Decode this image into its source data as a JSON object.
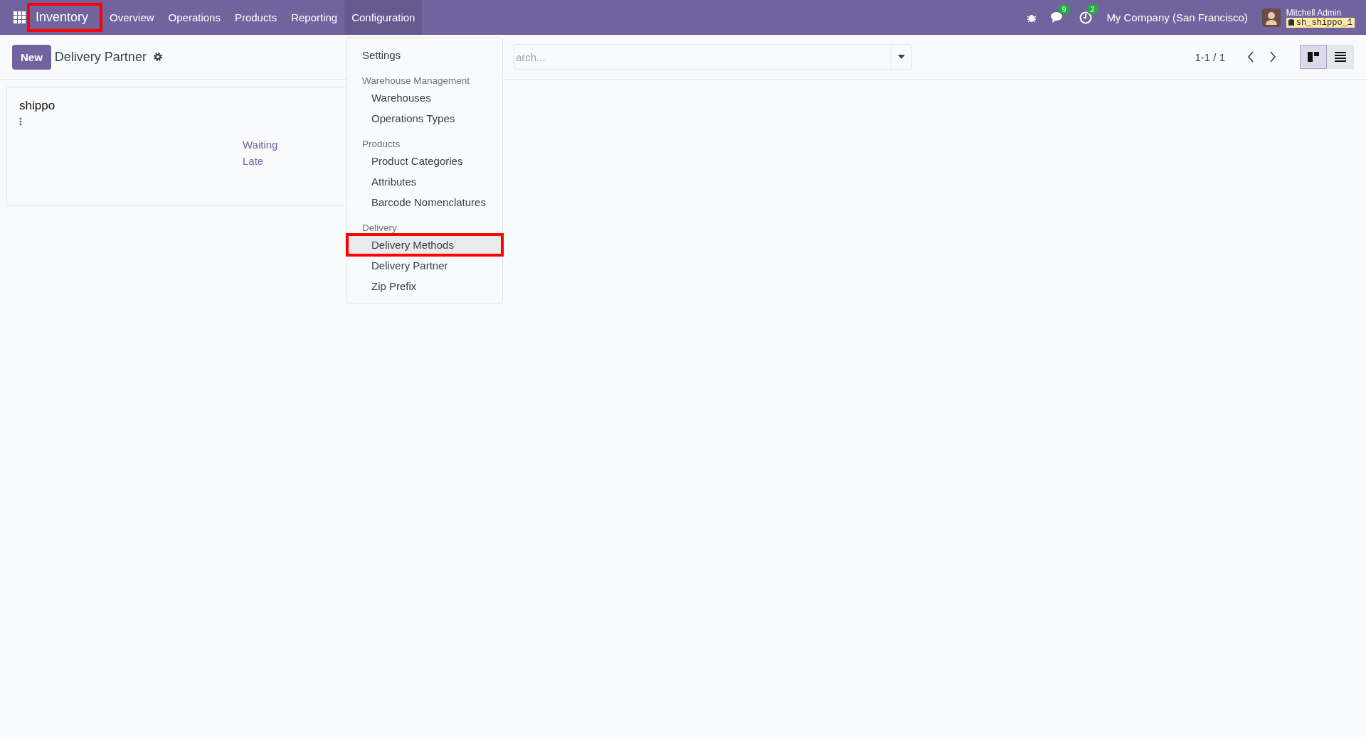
{
  "navbar": {
    "app_name": {
      "label": "Inventory",
      "highlighted": true
    },
    "menus": [
      {
        "label": "Overview",
        "selected": false
      },
      {
        "label": "Operations",
        "selected": false
      },
      {
        "label": "Products",
        "selected": false
      },
      {
        "label": "Reporting",
        "selected": false
      },
      {
        "label": "Configuration",
        "selected": true
      }
    ],
    "messages_badge": "9",
    "activities_badge": "2",
    "company": "My Company (San Francisco)",
    "user": "Mitchell Admin",
    "database": "sh_shippo_1"
  },
  "control_panel": {
    "new_button": "New",
    "title": "Delivery Partner",
    "search": {
      "placeholder": "arch..."
    },
    "pager": "1-1 / 1",
    "views": [
      {
        "kind": "kanban",
        "selected": true
      },
      {
        "kind": "list",
        "selected": false
      }
    ]
  },
  "card": {
    "title": "shippo",
    "links": [
      "Waiting",
      "Late"
    ]
  },
  "dropdown": [
    {
      "kind": "item",
      "label": "Settings",
      "highlighted": false
    },
    {
      "kind": "header",
      "label": "Warehouse Management"
    },
    {
      "kind": "subitem",
      "label": "Warehouses",
      "highlighted": false
    },
    {
      "kind": "subitem",
      "label": "Operations Types",
      "highlighted": false
    },
    {
      "kind": "header",
      "label": "Products"
    },
    {
      "kind": "subitem",
      "label": "Product Categories",
      "highlighted": false
    },
    {
      "kind": "subitem",
      "label": "Attributes",
      "highlighted": false
    },
    {
      "kind": "subitem",
      "label": "Barcode Nomenclatures",
      "highlighted": false
    },
    {
      "kind": "header",
      "label": "Delivery"
    },
    {
      "kind": "subitem",
      "label": "Delivery Methods",
      "highlighted": true
    },
    {
      "kind": "subitem",
      "label": "Delivery Partner",
      "highlighted": false
    },
    {
      "kind": "subitem",
      "label": "Zip Prefix",
      "highlighted": false
    }
  ]
}
